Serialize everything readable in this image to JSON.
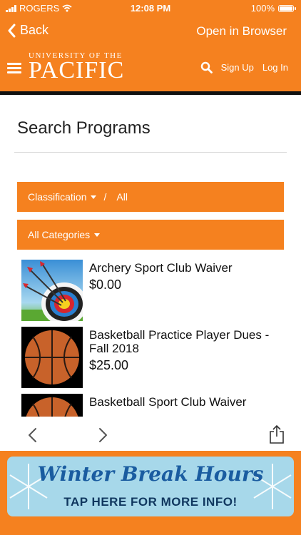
{
  "status": {
    "carrier": "ROGERS",
    "time": "12:08 PM",
    "battery": "100%"
  },
  "nav": {
    "back_label": "Back",
    "open_label": "Open in Browser"
  },
  "header": {
    "logo_top": "UNIVERSITY OF THE",
    "logo_main": "PACIFIC",
    "signup": "Sign Up",
    "login": "Log In"
  },
  "page": {
    "title": "Search Programs"
  },
  "filters": {
    "classification": "Classification",
    "separator": "/",
    "all": "All",
    "categories": "All Categories"
  },
  "items": [
    {
      "title": "Archery Sport Club Waiver",
      "price": "$0.00"
    },
    {
      "title": "Basketball Practice Player Dues - Fall 2018",
      "price": "$25.00"
    },
    {
      "title": "Basketball Sport Club Waiver",
      "price": ""
    }
  ],
  "banner": {
    "title": "Winter Break Hours",
    "subtitle": "TAP HERE FOR MORE INFO!"
  },
  "colors": {
    "brand": "#F5811F"
  }
}
